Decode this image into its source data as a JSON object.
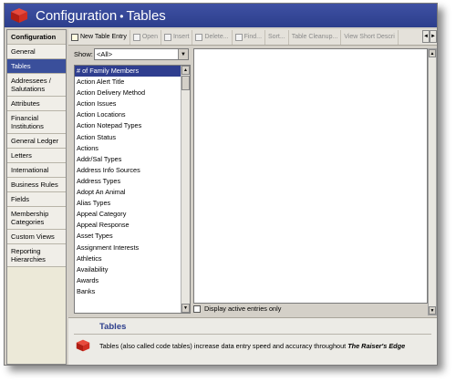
{
  "window": {
    "title_part1": "Configuration",
    "title_separator": "•",
    "title_part2": "Tables",
    "app_icon": "red-cube-icon"
  },
  "leftnav": {
    "items": [
      {
        "label": "Configuration",
        "kind": "header"
      },
      {
        "label": "General"
      },
      {
        "label": "Tables",
        "selected": true
      },
      {
        "label": "Addressees / Salutations"
      },
      {
        "label": "Attributes"
      },
      {
        "label": "Financial Institutions"
      },
      {
        "label": "General Ledger"
      },
      {
        "label": "Letters"
      },
      {
        "label": "International"
      },
      {
        "label": "Business Rules"
      },
      {
        "label": "Fields"
      },
      {
        "label": "Membership Categories"
      },
      {
        "label": "Custom Views"
      },
      {
        "label": "Reporting Hierarchies"
      }
    ]
  },
  "toolbar": {
    "buttons": [
      {
        "label": "New Table Entry",
        "icon": "new-entry-icon",
        "enabled": true
      },
      {
        "label": "Open",
        "icon": "open-icon",
        "enabled": false
      },
      {
        "label": "Insert",
        "icon": "insert-icon",
        "enabled": false
      },
      {
        "label": "Delete...",
        "icon": "delete-icon",
        "enabled": false
      },
      {
        "label": "Find...",
        "icon": "find-icon",
        "enabled": false
      },
      {
        "label": "Sort...",
        "icon": "",
        "enabled": false
      },
      {
        "label": "Table Cleanup...",
        "icon": "",
        "enabled": false
      },
      {
        "label": "View Short Descri",
        "icon": "",
        "enabled": false
      }
    ],
    "scroll_left": "◄",
    "scroll_right": "►"
  },
  "show": {
    "label": "Show:",
    "selected": "<All>"
  },
  "tables_list": {
    "items": [
      "# of Family Members",
      "Action Alert Title",
      "Action Delivery Method",
      "Action Issues",
      "Action Locations",
      "Action Notepad Types",
      "Action Status",
      "Actions",
      "Addr/Sal Types",
      "Address Info Sources",
      "Address Types",
      "Adopt An Animal",
      "Alias Types",
      "Appeal  Category",
      "Appeal Response",
      "Asset Types",
      "Assignment Interests",
      "Athletics",
      "Availability",
      "Awards",
      "Banks"
    ],
    "selected_index": 0
  },
  "active_entries": {
    "label": "Display active entries only",
    "checked": false
  },
  "info": {
    "title": "Tables",
    "text_prefix": "Tables (also called code tables) increase data entry speed and accuracy throughout ",
    "text_product": "The Raiser's Edge"
  },
  "colors": {
    "title_bar": "#2c3e8c",
    "selection": "#2f3e8f",
    "brand_red": "#c0241c"
  }
}
